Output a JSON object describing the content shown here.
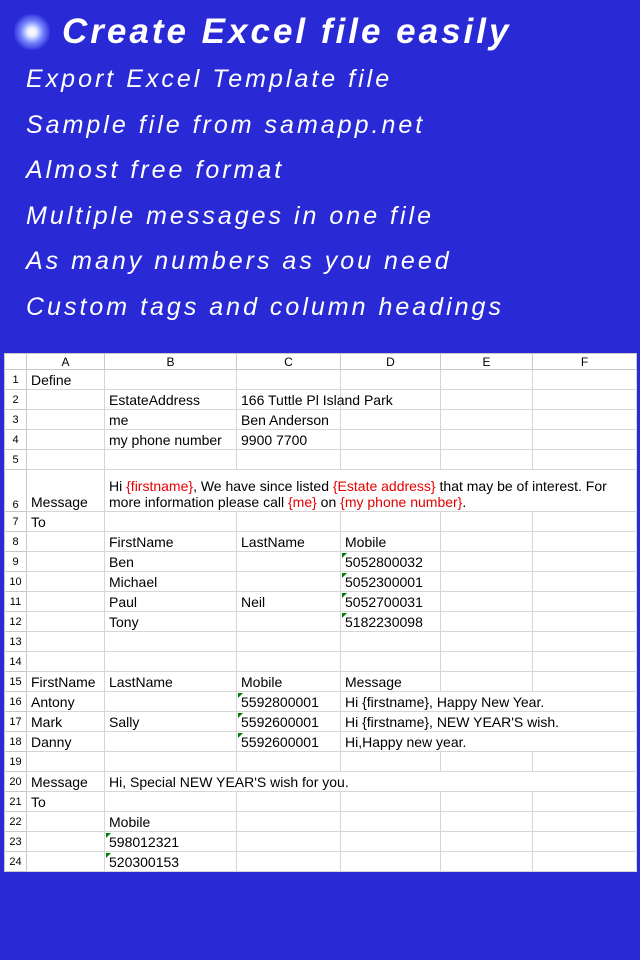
{
  "banner": {
    "title": "Create Excel file easily",
    "bullets": [
      "Export Excel Template file",
      "Sample file from samapp.net",
      "Almost free format",
      "Multiple messages in one file",
      "As many numbers as you need",
      "Custom tags and column headings"
    ]
  },
  "sheet": {
    "columns": [
      "A",
      "B",
      "C",
      "D",
      "E",
      "F"
    ],
    "r1": {
      "A": "Define"
    },
    "r2": {
      "B": "EstateAddress",
      "C": "166 Tuttle Pl Island Park"
    },
    "r3": {
      "B": "me",
      "C": "Ben Anderson"
    },
    "r4": {
      "B": "my phone number",
      "C": "9900 7700"
    },
    "r6": {
      "A": "Message",
      "msg_pre": "Hi ",
      "msg_t1": "{firstname}",
      "msg_mid1": ", We have since listed ",
      "msg_t2": "{Estate address}",
      "msg_mid2": " that may be of interest. For more information please call ",
      "msg_t3": "{me}",
      "msg_mid3": " on ",
      "msg_t4": "{my phone number}",
      "msg_post": "."
    },
    "r7": {
      "A": "To"
    },
    "r8": {
      "B": "FirstName",
      "C": "LastName",
      "D": "Mobile"
    },
    "r9": {
      "B": "Ben",
      "D": "5052800032"
    },
    "r10": {
      "B": "Michael",
      "D": "5052300001"
    },
    "r11": {
      "B": "Paul",
      "C": "Neil",
      "D": "5052700031"
    },
    "r12": {
      "B": "Tony",
      "D": "5182230098"
    },
    "r15": {
      "A": "FirstName",
      "B": "LastName",
      "C": "Mobile",
      "D": "Message"
    },
    "r16": {
      "A": "Antony",
      "C": "5592800001",
      "D": "Hi {firstname}, Happy New Year."
    },
    "r17": {
      "A": "Mark",
      "B": "Sally",
      "C": "5592600001",
      "D": "Hi {firstname}, NEW YEAR'S wish."
    },
    "r18": {
      "A": "Danny",
      "C": "5592600001",
      "D": "Hi,Happy new year."
    },
    "r20": {
      "A": "Message",
      "B": "Hi, Special NEW YEAR'S wish for you."
    },
    "r21": {
      "A": "To"
    },
    "r22": {
      "B": "Mobile"
    },
    "r23": {
      "B": "598012321"
    },
    "r24": {
      "B": "520300153"
    }
  }
}
